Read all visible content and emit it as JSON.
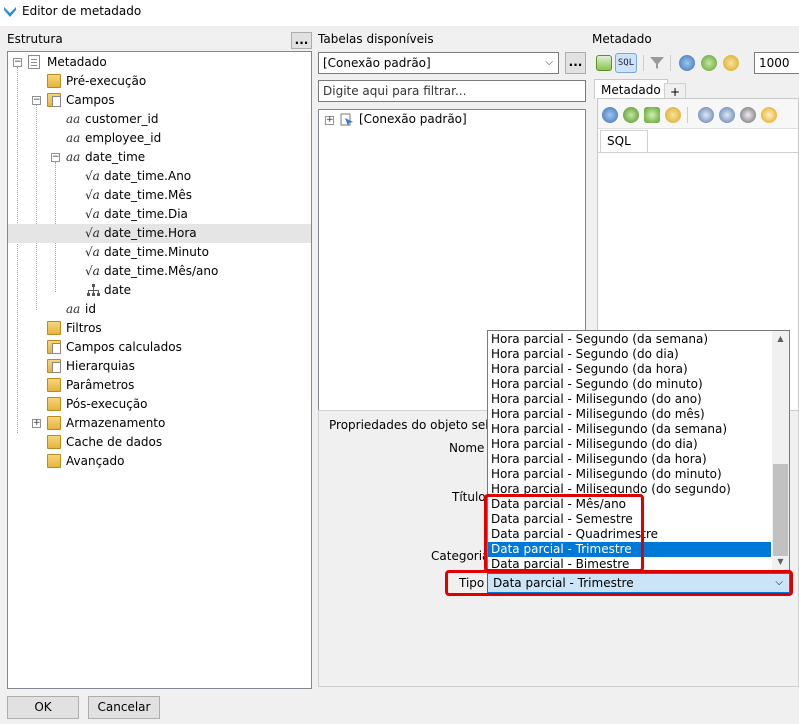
{
  "window": {
    "title": "Editor de metadado"
  },
  "left": {
    "label": "Estrutura",
    "more": "...",
    "tree": [
      {
        "label": "Metadado",
        "icon": "root-doc-icon"
      },
      {
        "label": "Pré-execução",
        "icon": "folder-icon"
      },
      {
        "label": "Campos",
        "icon": "folder-doc-icon"
      },
      {
        "label": "customer_id",
        "icon": "text-field-icon"
      },
      {
        "label": "employee_id",
        "icon": "text-field-icon"
      },
      {
        "label": "date_time",
        "icon": "text-field-icon"
      },
      {
        "label": "date_time.Ano",
        "icon": "formula-field-icon"
      },
      {
        "label": "date_time.Mês",
        "icon": "formula-field-icon"
      },
      {
        "label": "date_time.Dia",
        "icon": "formula-field-icon"
      },
      {
        "label": "date_time.Hora",
        "icon": "formula-field-icon"
      },
      {
        "label": "date_time.Minuto",
        "icon": "formula-field-icon"
      },
      {
        "label": "date_time.Mês/ano",
        "icon": "formula-field-icon"
      },
      {
        "label": "date",
        "icon": "hierarchy-icon"
      },
      {
        "label": "id",
        "icon": "text-field-icon"
      },
      {
        "label": "Filtros",
        "icon": "folder-icon"
      },
      {
        "label": "Campos calculados",
        "icon": "folder-doc-icon"
      },
      {
        "label": "Hierarquias",
        "icon": "folder-doc-icon"
      },
      {
        "label": "Parâmetros",
        "icon": "folder-icon"
      },
      {
        "label": "Pós-execução",
        "icon": "folder-icon"
      },
      {
        "label": "Armazenamento",
        "icon": "folder-icon"
      },
      {
        "label": "Cache de dados",
        "icon": "folder-icon"
      },
      {
        "label": "Avançado",
        "icon": "folder-icon"
      }
    ]
  },
  "middle": {
    "label": "Tabelas disponíveis",
    "connection": "[Conexão padrão]",
    "more": "...",
    "filter_placeholder": "Digite aqui para filtrar...",
    "tree_root": "[Conexão padrão]",
    "props_label": "Propriedades do objeto seleci",
    "fields": {
      "nome": "Nome",
      "titulo": "Título",
      "categoria": "Categoria",
      "tipo": "Tipo"
    }
  },
  "right": {
    "label": "Metadado",
    "limit": "1000",
    "tabs": [
      "Metadado",
      "+"
    ],
    "subtab": "SQL"
  },
  "dropdown": {
    "options": [
      "Hora parcial - Segundo (da semana)",
      "Hora parcial - Segundo (do dia)",
      "Hora parcial - Segundo (da hora)",
      "Hora parcial - Segundo (do minuto)",
      "Hora parcial - Milisegundo (do ano)",
      "Hora parcial - Milisegundo (do mês)",
      "Hora parcial - Milisegundo (da semana)",
      "Hora parcial - Milisegundo (do dia)",
      "Hora parcial - Milisegundo (da hora)",
      "Hora parcial - Milisegundo (do minuto)",
      "Hora parcial - Milisegundo (do segundo)",
      "Data parcial - Mês/ano",
      "Data parcial - Semestre",
      "Data parcial - Quadrimestre",
      "Data parcial - Trimestre",
      "Data parcial - Bimestre"
    ],
    "selected": "Data parcial - Trimestre"
  },
  "buttons": {
    "ok": "OK",
    "cancel": "Cancelar"
  },
  "colors": {
    "selection": "#0078d7",
    "highlight_box": "#e00000",
    "folder": "#e6b43b"
  }
}
